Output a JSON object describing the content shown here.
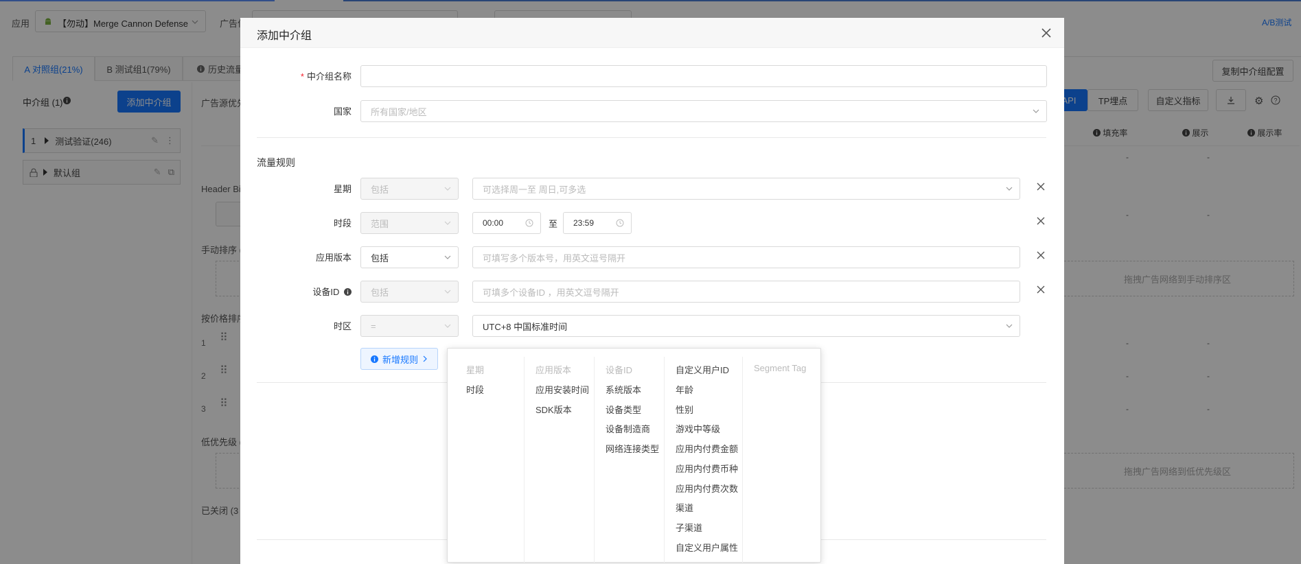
{
  "topbar": {
    "app_label": "应用",
    "app_value": "【勿动】Merge Cannon Defense",
    "adplace_label": "广告位",
    "ab_link": "A/B测试"
  },
  "tabs": [
    {
      "label": "A 对照组(21%)"
    },
    {
      "label": "B 测试组1(79%)"
    },
    {
      "label": "历史流量"
    }
  ],
  "left_panel": {
    "group_label": "中介组 (1)",
    "add_button": "添加中介组",
    "groups": [
      {
        "index": "1",
        "label": "测试验证(246)"
      },
      {
        "label": "默认组"
      }
    ]
  },
  "middle": {
    "adsource_priority": "广告源优先",
    "header_bidding": "Header Bi",
    "manual_sort": "手动排序 (",
    "price_sort": "按价格排序",
    "low_priority": "低优先级 (",
    "closed": "已关闭 (3",
    "rows": [
      "1",
      "2",
      "3"
    ],
    "dash": "-"
  },
  "right_toolbar": {
    "copy_config": "复制中介组配置",
    "api": "API",
    "tp": "TP埋点",
    "custom_metric": "自定义指标",
    "col_fill": "填充率",
    "col_show": "展示",
    "col_show_rate": "展示率",
    "drag_manual": "拖拽广告网络到手动排序区",
    "drag_low": "拖拽广告网络到低优先级区"
  },
  "modal": {
    "title": "添加中介组",
    "name_label": "中介组名称",
    "name_value": "",
    "country_label": "国家",
    "country_placeholder": "所有国家/地区",
    "traffic_rules_title": "流量规则",
    "rules": {
      "weekday": {
        "label": "星期",
        "op": "包括",
        "placeholder": "可选择周一至 周日,可多选"
      },
      "period": {
        "label": "时段",
        "op": "范围",
        "start": "00:00",
        "to": "至",
        "end": "23:59"
      },
      "app_version": {
        "label": "应用版本",
        "op": "包括",
        "placeholder": "可填写多个版本号，用英文逗号隔开"
      },
      "device_id": {
        "label": "设备ID",
        "op": "包括",
        "placeholder": "可填多个设备ID ，用英文逗号隔开"
      },
      "timezone": {
        "label": "时区",
        "op": "=",
        "value": "UTC+8 中国标准时间"
      }
    },
    "add_rule_button": "新增规则"
  },
  "rule_menu": {
    "columns": [
      {
        "header": "星期",
        "items": [
          "时段"
        ]
      },
      {
        "header": "应用版本",
        "items": [
          "应用安装时间",
          "SDK版本"
        ]
      },
      {
        "header": "设备ID",
        "items": [
          "系统版本",
          "设备类型",
          "设备制造商",
          "网络连接类型"
        ]
      },
      {
        "header": "自定义用户ID",
        "items": [
          "年龄",
          "性别",
          "游戏中等级",
          "应用内付费金额",
          "应用内付费币种",
          "应用内付费次数",
          "渠道",
          "子渠道",
          "自定义用户属性"
        ]
      },
      {
        "header": "Segment Tag",
        "items": []
      }
    ]
  }
}
